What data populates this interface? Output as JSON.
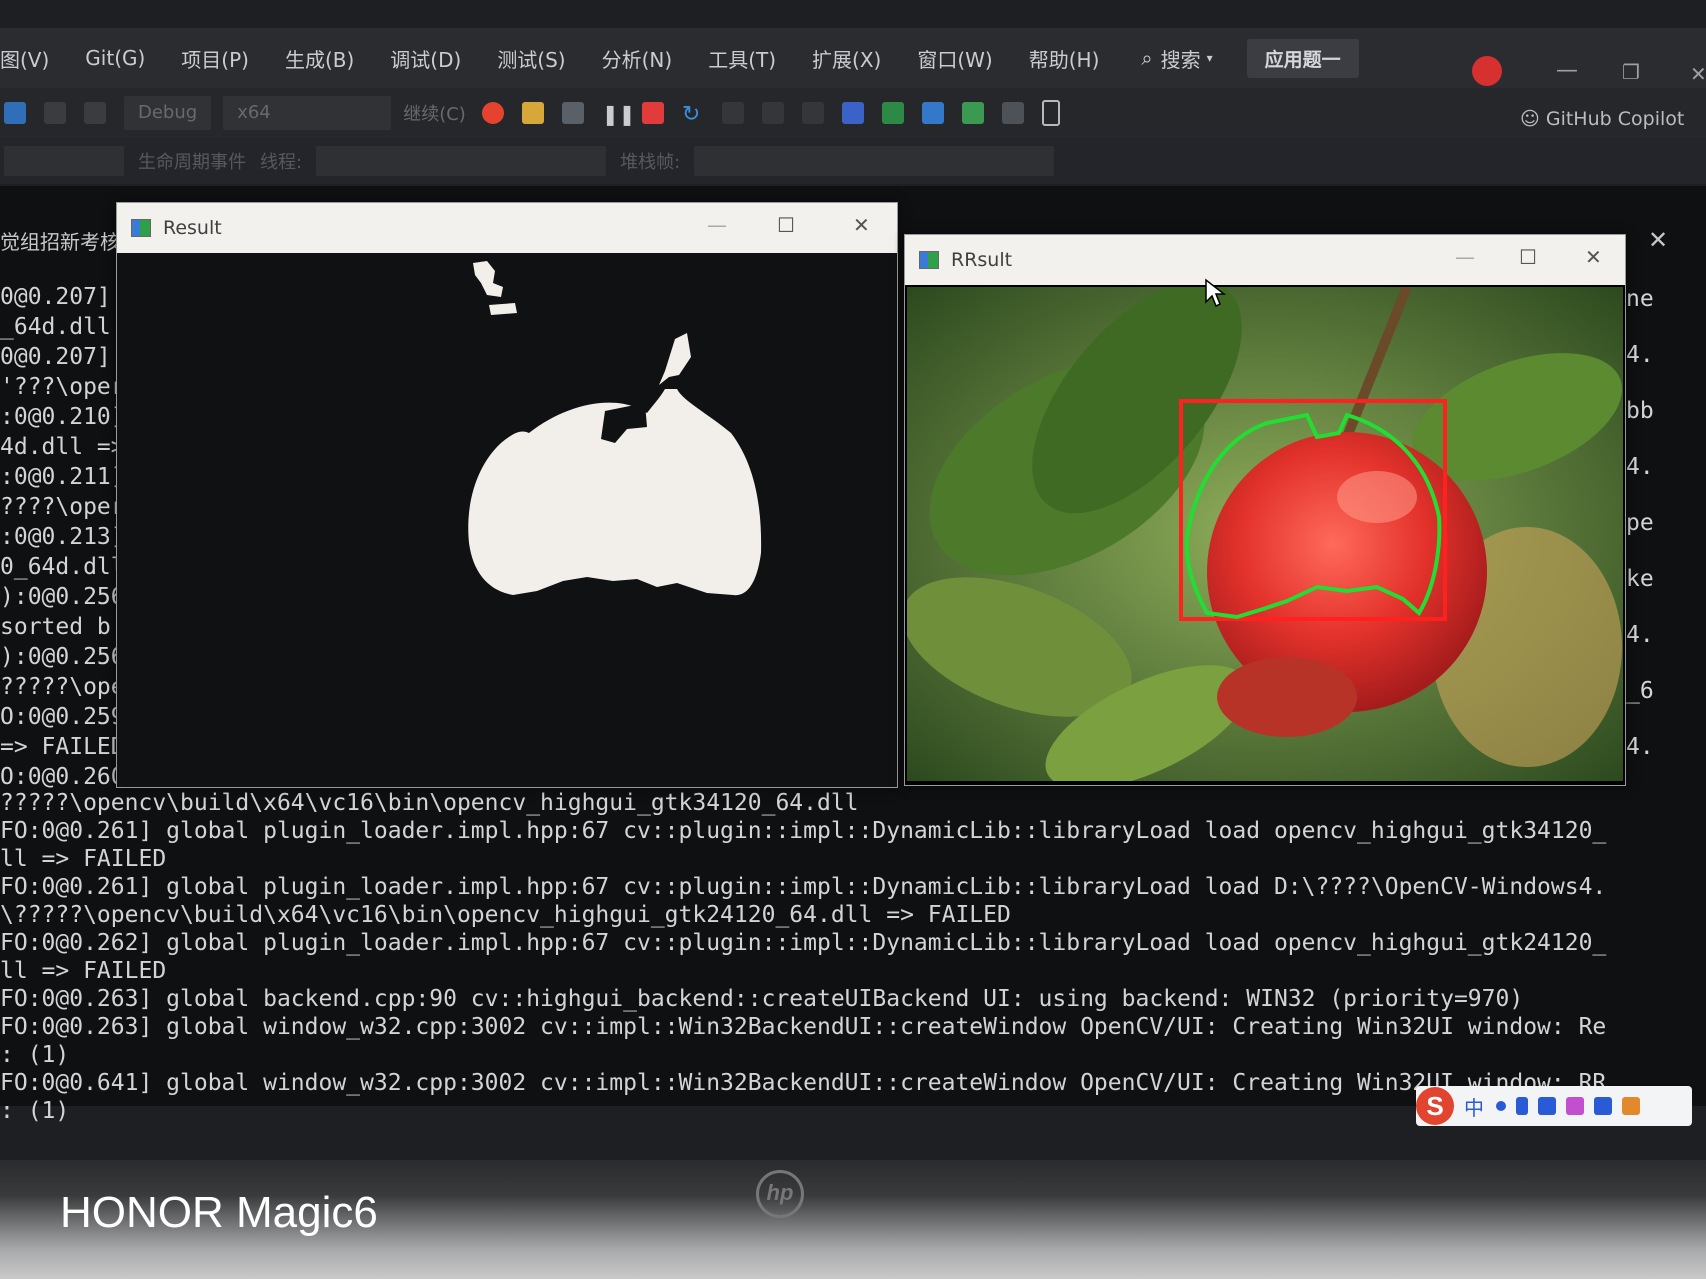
{
  "menubar": {
    "items": [
      "图(V)",
      "Git(G)",
      "项目(P)",
      "生成(B)",
      "调试(D)",
      "测试(S)",
      "分析(N)",
      "工具(T)",
      "扩展(X)",
      "窗口(W)",
      "帮助(H)"
    ],
    "search_label": "搜索",
    "app_label": "应用题一"
  },
  "toolbar": {
    "config_dropdown": "Debug",
    "platform_dropdown": "x64",
    "continue_label": "继续(C)",
    "copilot_label": "GitHub Copilot"
  },
  "toolbar2": {
    "lifecycle_label": "生命周期事件",
    "thread_label": "线程:",
    "stack_label": "堆栈帧:"
  },
  "side_panel": {
    "title_fragment": "觉组招新考核"
  },
  "result_window": {
    "title": "Result"
  },
  "rresult_window": {
    "title": "RRsult"
  },
  "console": {
    "left_fragments": [
      "0@0.207]",
      "_64d.dll",
      "0@0.207]",
      "'???\\oper",
      ":0@0.210]",
      "4d.dll =>",
      ":0@0.211]",
      "????\\oper",
      ":0@0.213]",
      "0_64d.dll",
      "):0@0.256]",
      " sorted b",
      "):0@0.256]",
      "?????\\oper",
      "O:0@0.259]",
      " => FAILED",
      "O:0@0.260]"
    ],
    "right_fragments": [
      "ne",
      "4.",
      "bb",
      "4.",
      "pe",
      "ke",
      "4.",
      "_6",
      "4."
    ],
    "lines": [
      "?????\\opencv\\build\\x64\\vc16\\bin\\opencv_highgui_gtk34120_64.dll",
      "FO:0@0.261] global plugin_loader.impl.hpp:67 cv::plugin::impl::DynamicLib::libraryLoad load opencv_highgui_gtk34120_",
      "ll => FAILED",
      "FO:0@0.261] global plugin_loader.impl.hpp:67 cv::plugin::impl::DynamicLib::libraryLoad load D:\\????\\OpenCV-Windows4.",
      "\\?????\\opencv\\build\\x64\\vc16\\bin\\opencv_highgui_gtk24120_64.dll => FAILED",
      "FO:0@0.262] global plugin_loader.impl.hpp:67 cv::plugin::impl::DynamicLib::libraryLoad load opencv_highgui_gtk24120_",
      "ll => FAILED",
      "FO:0@0.263] global backend.cpp:90 cv::highgui_backend::createUIBackend UI: using backend: WIN32 (priority=970)",
      "FO:0@0.263] global window_w32.cpp:3002 cv::impl::Win32BackendUI::createWindow OpenCV/UI: Creating Win32UI window: Re",
      ": (1)",
      "FO:0@0.641] global window_w32.cpp:3002 cv::impl::Win32BackendUI::createWindow OpenCV/UI: Creating Win32UI window: RR",
      ": (1)"
    ]
  },
  "ime": {
    "logo": "S",
    "mode": "中"
  },
  "device": {
    "watermark": "HONOR Magic6",
    "brand_logo": "hp"
  },
  "colors": {
    "bbox_red": "#ff2020",
    "contour_green": "#22dd33",
    "mask_white": "#f2efea"
  }
}
